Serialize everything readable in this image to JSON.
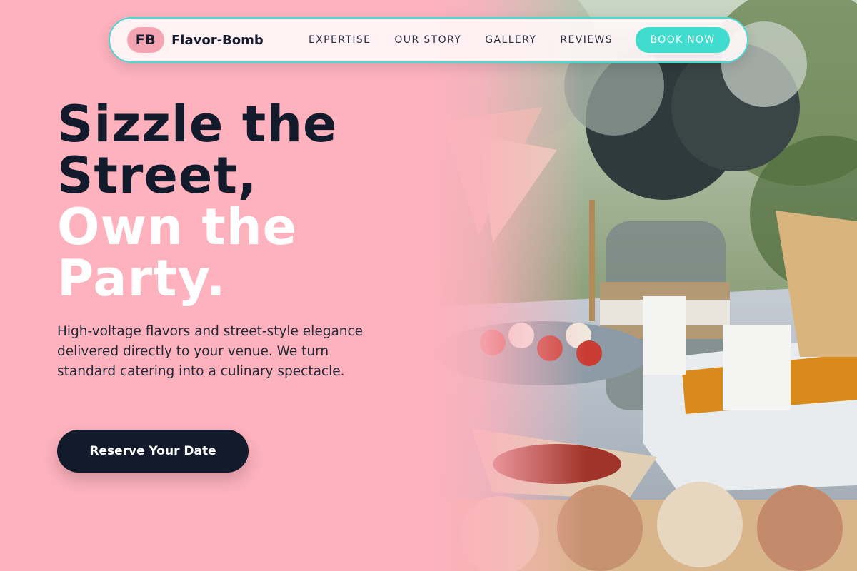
{
  "nav": {
    "logo_initials": "FB",
    "brand": "Flavor-Bomb",
    "links": [
      {
        "label": "EXPERTISE"
      },
      {
        "label": "OUR STORY"
      },
      {
        "label": "GALLERY"
      },
      {
        "label": "REVIEWS"
      }
    ],
    "cta_label": "BOOK NOW"
  },
  "hero": {
    "headline_dark": [
      "Sizzle the",
      "Street,"
    ],
    "headline_light": [
      "Own the",
      "Party."
    ],
    "subtitle": "High-voltage flavors and street-style elegance delivered directly to your venue. We turn standard catering into a culinary spectacle.",
    "cta_label": "Reserve Your Date"
  },
  "colors": {
    "background": "#fdb2bd",
    "accent": "#40dccd",
    "dark": "#131a2c",
    "logo_badge": "#f5a5b2"
  },
  "images": {
    "hero_photo": "outdoor catering table with flowers in jar, finger sandwiches, chips and charcuterie"
  }
}
